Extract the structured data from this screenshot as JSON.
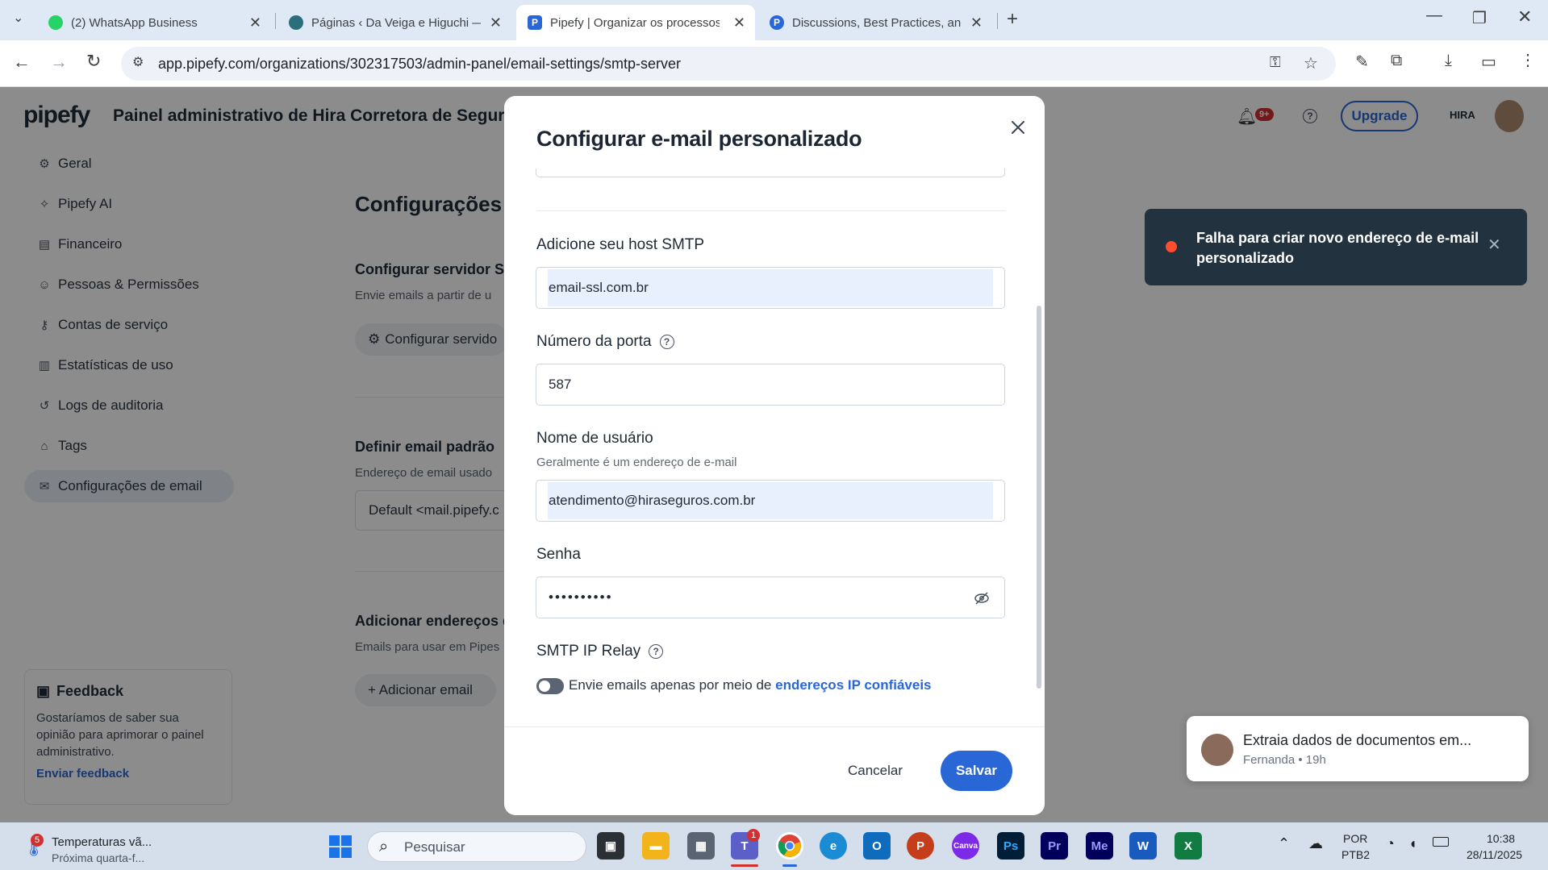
{
  "browser": {
    "tabs": [
      {
        "title": "(2) WhatsApp Business",
        "active": false
      },
      {
        "title": "Páginas ‹ Da Veiga e Higuchi —",
        "active": false
      },
      {
        "title": "Pipefy | Organizar os processos",
        "active": true
      },
      {
        "title": "Discussions, Best Practices, and",
        "active": false
      }
    ],
    "url": "app.pipefy.com/organizations/302317503/admin-panel/email-settings/smtp-server"
  },
  "app": {
    "brand": "pipefy",
    "header_title": "Painel administrativo de Hira Corretora de Seguros",
    "notif_count": "9+",
    "upgrade_label": "Upgrade",
    "org_logo": "HIRA",
    "sidebar": [
      {
        "label": "Geral",
        "icon": "gear-icon"
      },
      {
        "label": "Pipefy AI",
        "icon": "sparkle-icon"
      },
      {
        "label": "Financeiro",
        "icon": "receipt-icon"
      },
      {
        "label": "Pessoas & Permissões",
        "icon": "people-icon"
      },
      {
        "label": "Contas de serviço",
        "icon": "key-icon"
      },
      {
        "label": "Estatísticas de uso",
        "icon": "bar-chart-icon"
      },
      {
        "label": "Logs de auditoria",
        "icon": "history-icon"
      },
      {
        "label": "Tags",
        "icon": "tag-icon"
      },
      {
        "label": "Configurações de email",
        "icon": "mail-icon",
        "active": true
      }
    ],
    "feedback": {
      "title": "Feedback",
      "body": "Gostaríamos de saber sua opinião para aprimorar o painel administrativo.",
      "link": "Enviar feedback"
    },
    "main": {
      "page_title": "Configurações d",
      "smtp_title": "Configurar servidor SM",
      "smtp_desc": "Envie emails a partir de u",
      "smtp_button": "Configurar servido",
      "default_title": "Definir email padrão",
      "default_desc": "Endereço de email usado",
      "default_value": "Default <mail.pipefy.c",
      "add_title": "Adicionar endereços d",
      "add_desc": "Emails para usar em Pipes",
      "add_button": "+ Adicionar email"
    }
  },
  "modal": {
    "title": "Configurar e-mail personalizado",
    "host_label": "Adicione seu host SMTP",
    "host_value": "email-ssl.com.br",
    "port_label": "Número da porta",
    "port_value": "587",
    "user_label": "Nome de usuário",
    "user_help": "Geralmente é um endereço de e-mail",
    "user_value": "atendimento@hiraseguros.com.br",
    "password_label": "Senha",
    "password_value": "••••••••••",
    "relay_label": "SMTP IP Relay",
    "relay_text": "Envie emails apenas por meio de",
    "relay_link": "endereços IP confiáveis",
    "relay_enabled": false,
    "cancel_label": "Cancelar",
    "save_label": "Salvar"
  },
  "toast": {
    "message": "Falha para criar novo endereço de e-mail personalizado",
    "status_color": "#ff4d2e"
  },
  "notification": {
    "title": "Extraia dados de documentos em...",
    "meta": "Fernanda • 19h"
  },
  "taskbar": {
    "weather_title": "Temperaturas vã...",
    "weather_sub": "Próxima quarta-f...",
    "weather_badge": "5",
    "search_placeholder": "Pesquisar",
    "teams_badge": "1",
    "lang_top": "POR",
    "lang_bottom": "PTB2",
    "time": "10:38",
    "date": "28/11/2025"
  },
  "colors": {
    "accent": "#2966d6",
    "toast_bg": "#22333f"
  }
}
